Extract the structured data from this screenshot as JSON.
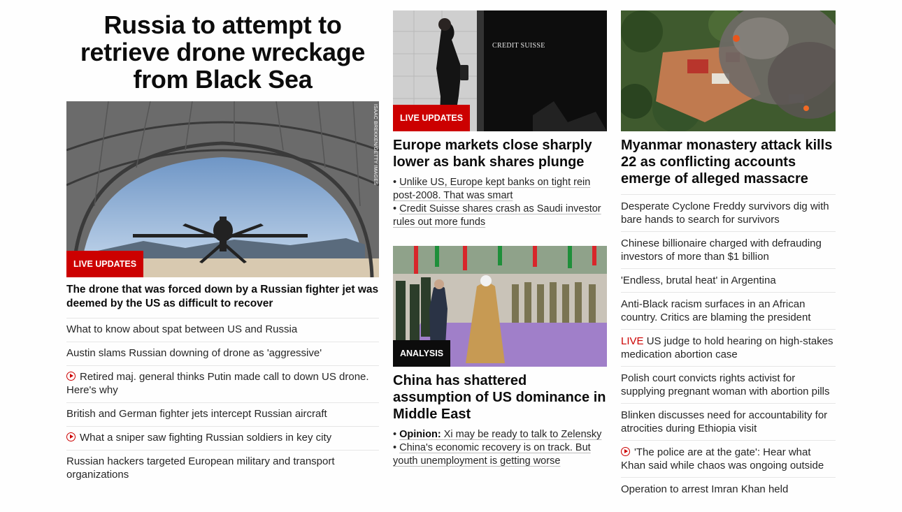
{
  "col1": {
    "headline": "Russia to attempt to retrieve drone wreckage from Black Sea",
    "image_credit": "ISAAC BREKKEN/GETTY IMAGES",
    "badge": "LIVE UPDATES",
    "lead": "The drone that was forced down by a Russian fighter jet was deemed by the US as difficult to recover",
    "items": [
      {
        "text": "What to know about spat between US and Russia",
        "video": false
      },
      {
        "text": "Austin slams Russian downing of drone as 'aggressive'",
        "video": false
      },
      {
        "text": "Retired maj. general thinks Putin made call to down US drone. Here's why",
        "video": true
      },
      {
        "text": "British and German fighter jets intercept Russian aircraft",
        "video": false
      },
      {
        "text": "What a sniper saw fighting Russian soldiers in key city",
        "video": true
      },
      {
        "text": "Russian hackers targeted European military and transport organizations",
        "video": false
      }
    ]
  },
  "col2": {
    "story1": {
      "image_text": "CREDIT SUISSE",
      "badge": "LIVE UPDATES",
      "headline": "Europe markets close sharply lower as bank shares plunge",
      "bullets": [
        {
          "prefix": "",
          "text": "Unlike US, Europe kept banks on tight rein post-2008. That was smart"
        },
        {
          "prefix": "",
          "text": "Credit Suisse shares crash as Saudi investor rules out more funds"
        }
      ]
    },
    "story2": {
      "badge": "ANALYSIS",
      "headline": "China has shattered assumption of US dominance in Middle East",
      "bullets": [
        {
          "prefix": "Opinion:",
          "text": "Xi may be ready to talk to Zelensky"
        },
        {
          "prefix": "",
          "text": "China's economic recovery is on track. But youth unemployment is getting worse"
        }
      ]
    }
  },
  "col3": {
    "headline": "Myanmar monastery attack kills 22 as conflicting accounts emerge of alleged massacre",
    "items": [
      {
        "text": "Desperate Cyclone Freddy survivors dig with bare hands to search for survivors",
        "video": false,
        "live": ""
      },
      {
        "text": "Chinese billionaire charged with defrauding investors of more than $1 billion",
        "video": false,
        "live": ""
      },
      {
        "text": "'Endless, brutal heat' in Argentina",
        "video": false,
        "live": ""
      },
      {
        "text": "Anti-Black racism surfaces in an African country. Critics are blaming the president",
        "video": false,
        "live": ""
      },
      {
        "text": "US judge to hold hearing on high-stakes medication abortion case",
        "video": false,
        "live": "LIVE"
      },
      {
        "text": "Polish court convicts rights activist for supplying pregnant woman with abortion pills",
        "video": false,
        "live": ""
      },
      {
        "text": "Blinken discusses need for accountability for atrocities during Ethiopia visit",
        "video": false,
        "live": ""
      },
      {
        "text": "'The police are at the gate': Hear what Khan said while chaos was ongoing outside",
        "video": true,
        "live": ""
      },
      {
        "text": "Operation to arrest Imran Khan held",
        "video": false,
        "live": ""
      }
    ]
  },
  "colors": {
    "accent": "#cc0000",
    "text": "#0c0c0c",
    "divider": "#e6e6e6"
  },
  "icons": {
    "video": "play-circle-icon"
  }
}
